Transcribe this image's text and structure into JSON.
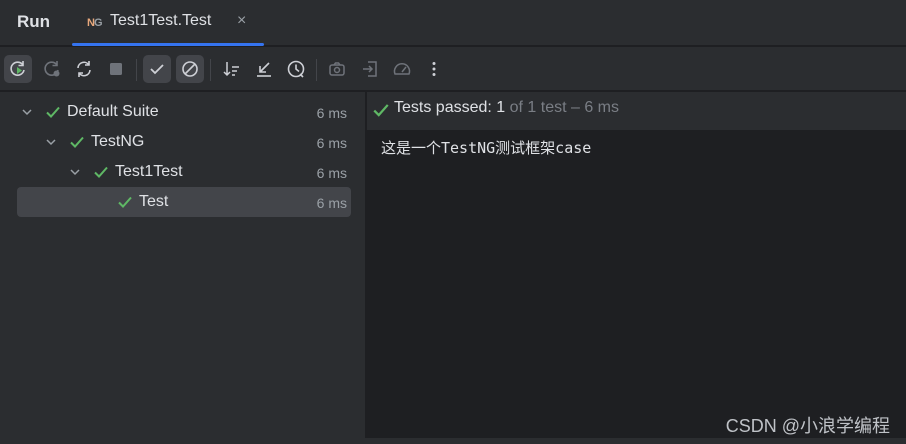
{
  "window": {
    "title": "Run"
  },
  "tab": {
    "icon": "testng-icon",
    "icon_text_n": "N",
    "icon_text_g": "G",
    "label": "Test1Test.Test",
    "close": "×"
  },
  "toolbar": {
    "buttons": [
      {
        "name": "rerun-icon",
        "active": true
      },
      {
        "name": "rerun-failed-icon",
        "active": false
      },
      {
        "name": "toggle-auto-test-icon",
        "active": false
      },
      {
        "name": "stop-icon",
        "active": false
      },
      {
        "name": "show-passed-icon",
        "active": true
      },
      {
        "name": "show-ignored-icon",
        "active": true
      },
      {
        "name": "sort-icon",
        "active": false
      },
      {
        "name": "collapse-icon",
        "active": false
      },
      {
        "name": "history-icon",
        "active": false
      },
      {
        "name": "camera-icon",
        "active": false
      },
      {
        "name": "import-icon",
        "active": false
      },
      {
        "name": "speed-icon",
        "active": false
      },
      {
        "name": "more-icon",
        "active": false
      }
    ]
  },
  "tree": {
    "items": [
      {
        "label": "Default Suite",
        "duration": "6 ms",
        "level": 0,
        "status": "passed",
        "expanded": true
      },
      {
        "label": "TestNG",
        "duration": "6 ms",
        "level": 1,
        "status": "passed",
        "expanded": true
      },
      {
        "label": "Test1Test",
        "duration": "6 ms",
        "level": 2,
        "status": "passed",
        "expanded": true
      },
      {
        "label": "Test",
        "duration": "6 ms",
        "level": 3,
        "status": "passed",
        "selected": true
      }
    ]
  },
  "status": {
    "passed_label": "Tests passed: 1",
    "rest": " of 1 test – 6 ms"
  },
  "console": {
    "output": "这是一个TestNG测试框架case"
  },
  "watermark": "CSDN @小浪学编程",
  "colors": {
    "accent": "#3574f0",
    "pass": "#5fb865",
    "panel": "#2b2d30",
    "editor": "#1e1f22"
  }
}
